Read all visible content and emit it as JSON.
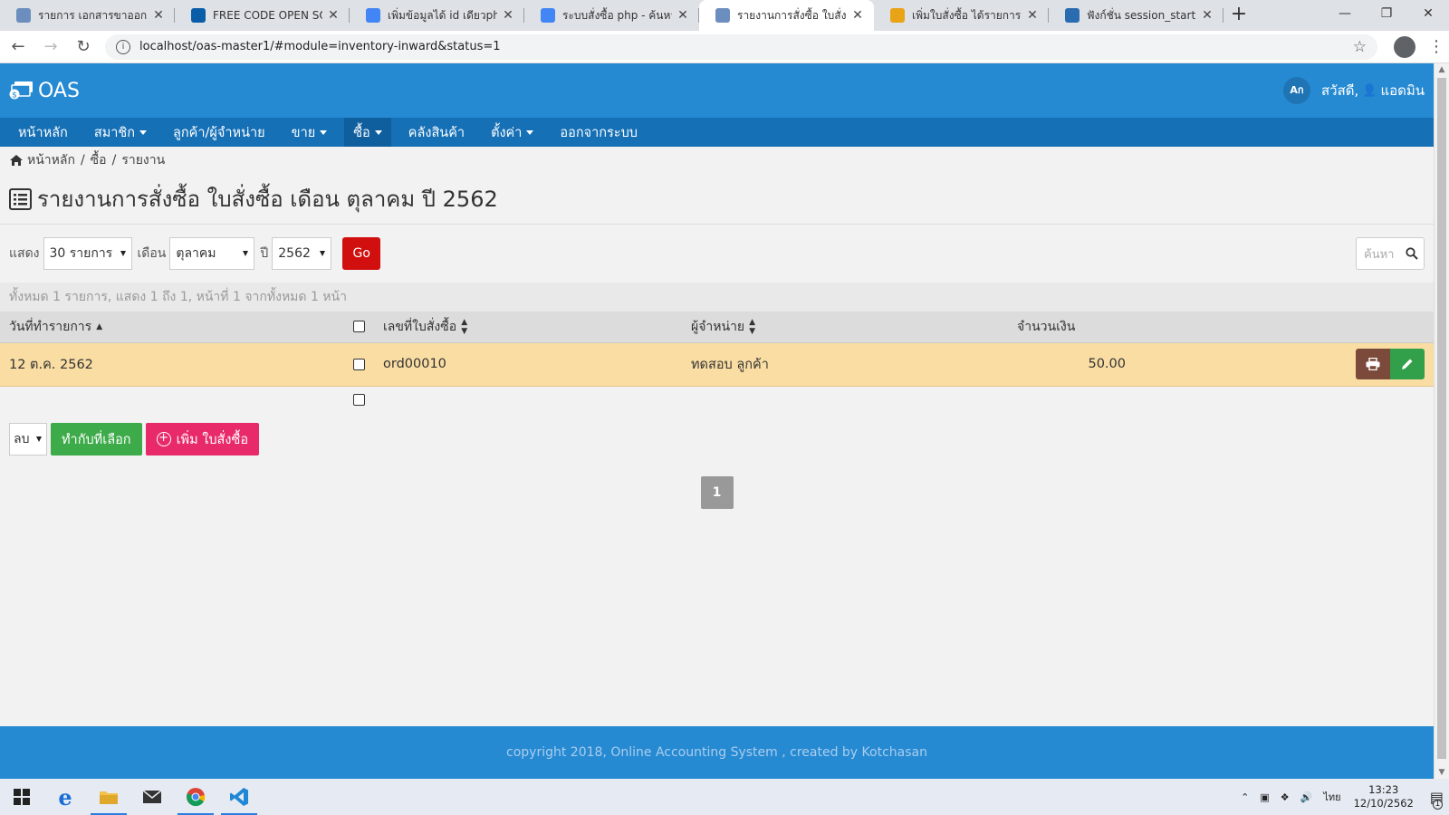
{
  "browser": {
    "tabs": [
      {
        "title": "รายการ เอกสารขาออก",
        "color": "#6c8ebf"
      },
      {
        "title": "FREE CODE OPEN SOURCE",
        "color": "#0a5ea8"
      },
      {
        "title": "เพิ่มข้อมูลได้ id เดียวphp - ค้นหาด้วย Google",
        "color": "#4285f4"
      },
      {
        "title": "ระบบสั่งซื้อ php - ค้นหาด้วย Google",
        "color": "#4285f4"
      },
      {
        "title": "รายงานการสั่งซื้อ ใบสั่งซื้อ เดือน ตุลาคม",
        "color": "#6c8ebf"
      },
      {
        "title": "เพิ่มใบสั่งซื้อ ได้รายการเดียวค่ะ",
        "color": "#e8a317"
      },
      {
        "title": "ฟังก์ชั่น session_start() : ไม่สามารถ",
        "color": "#2b6cb0"
      }
    ],
    "active_tab": 4,
    "url": "localhost/oas-master1/#module=inventory-inward&status=1"
  },
  "app": {
    "logo": "OAS",
    "lang": "Aก",
    "greeting": "สวัสดี,",
    "username": "แอดมิน"
  },
  "menu": [
    {
      "label": "หน้าหลัก",
      "dropdown": false,
      "active": false
    },
    {
      "label": "สมาชิก",
      "dropdown": true,
      "active": false
    },
    {
      "label": "ลูกค้า/ผู้จำหน่าย",
      "dropdown": false,
      "active": false
    },
    {
      "label": "ขาย",
      "dropdown": true,
      "active": false
    },
    {
      "label": "ซื้อ",
      "dropdown": true,
      "active": true
    },
    {
      "label": "คลังสินค้า",
      "dropdown": false,
      "active": false
    },
    {
      "label": "ตั้งค่า",
      "dropdown": true,
      "active": false
    },
    {
      "label": "ออกจากระบบ",
      "dropdown": false,
      "active": false
    }
  ],
  "breadcrumb": [
    "หน้าหลัก",
    "ซื้อ",
    "รายงาน"
  ],
  "page_title": "รายงานการสั่งซื้อ ใบสั่งซื้อ เดือน ตุลาคม ปี 2562",
  "filters": {
    "show_label": "แสดง",
    "show_value": "30 รายการ",
    "month_label": "เดือน",
    "month_value": "ตุลาคม",
    "year_label": "ปี",
    "year_value": "2562",
    "go_label": "Go",
    "search_placeholder": "ค้นหา"
  },
  "summary": "ทั้งหมด 1 รายการ, แสดง 1 ถึง 1, หน้าที่ 1 จากทั้งหมด 1 หน้า",
  "table": {
    "headers": {
      "date": "วันที่ทำรายการ",
      "order_no": "เลขที่ใบสั่งซื้อ",
      "supplier": "ผู้จำหน่าย",
      "amount": "จำนวนเงิน"
    },
    "rows": [
      {
        "date": "12 ต.ค. 2562",
        "order_no": "ord00010",
        "supplier": "ทดสอบ ลูกค้า",
        "amount": "50.00"
      }
    ]
  },
  "bulk": {
    "action_value": "ลบ",
    "apply_label": "ทำกับที่เลือก",
    "add_label": "เพิ่ม ใบสั่งซื้อ"
  },
  "pagination": {
    "current": "1"
  },
  "footer": "copyright 2018, Online Accounting System , created by Kotchasan",
  "taskbar": {
    "lang": "ไทย",
    "time": "13:23",
    "date": "12/10/2562",
    "notifications": "1"
  }
}
